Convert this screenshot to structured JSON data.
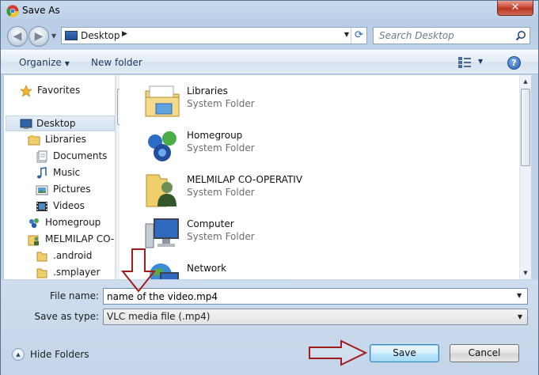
{
  "window": {
    "title": "Save As",
    "close_label": "✕"
  },
  "address_bar": {
    "location": "Desktop",
    "search_placeholder": "Search Desktop"
  },
  "toolbar": {
    "organize_label": "Organize",
    "new_folder_label": "New folder",
    "help_label": "?"
  },
  "nav_pane": {
    "items": [
      {
        "label": "Favorites",
        "icon": "star-icon"
      },
      {
        "label": "Desktop",
        "icon": "desktop-icon",
        "selected": true
      },
      {
        "label": "Libraries",
        "icon": "libraries-icon"
      },
      {
        "label": "Documents",
        "icon": "documents-icon"
      },
      {
        "label": "Music",
        "icon": "music-icon"
      },
      {
        "label": "Pictures",
        "icon": "pictures-icon"
      },
      {
        "label": "Videos",
        "icon": "videos-icon"
      },
      {
        "label": "Homegroup",
        "icon": "homegroup-icon"
      },
      {
        "label": "MELMILAP CO-O",
        "icon": "user-folder-icon"
      },
      {
        "label": ".android",
        "icon": "folder-icon"
      },
      {
        "label": ".smplayer",
        "icon": "folder-icon"
      }
    ]
  },
  "file_list": {
    "items": [
      {
        "name": "Libraries",
        "type": "System Folder",
        "icon": "libraries-icon"
      },
      {
        "name": "Homegroup",
        "type": "System Folder",
        "icon": "homegroup-icon"
      },
      {
        "name": "MELMILAP CO-OPERATIV",
        "type": "System Folder",
        "icon": "user-folder-icon"
      },
      {
        "name": "Computer",
        "type": "System Folder",
        "icon": "computer-icon"
      },
      {
        "name": "Network",
        "type": "",
        "icon": "network-icon"
      }
    ]
  },
  "form": {
    "file_name_label": "File name:",
    "file_name_value": "name of the video.mp4",
    "save_type_label": "Save as type:",
    "save_type_value": "VLC media file (.mp4)"
  },
  "footer": {
    "hide_folders_label": "Hide Folders",
    "save_label": "Save",
    "cancel_label": "Cancel"
  },
  "colors": {
    "annotation_arrow": "#a11d1d",
    "accent": "#3c7fb1"
  }
}
